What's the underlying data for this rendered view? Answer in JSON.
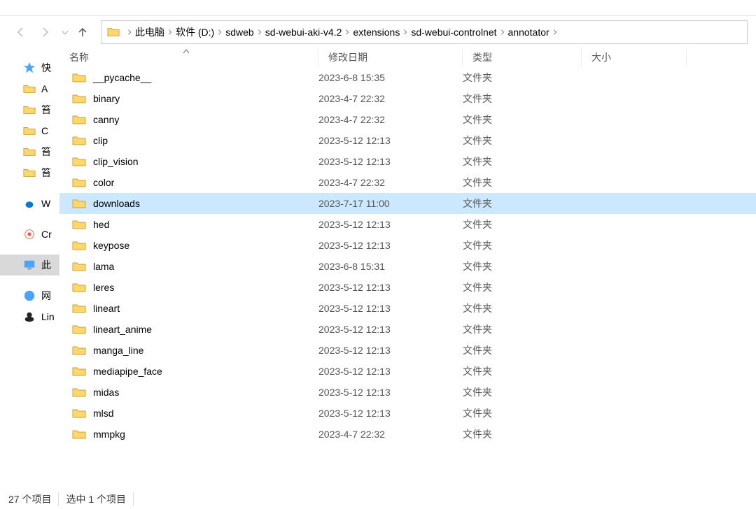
{
  "nav": {
    "back_enabled": false,
    "forward_enabled": false,
    "up_enabled": true
  },
  "breadcrumb": [
    "此电脑",
    "软件 (D:)",
    "sdweb",
    "sd-webui-aki-v4.2",
    "extensions",
    "sd-webui-controlnet",
    "annotator"
  ],
  "sidebar": {
    "quick_access_label": "快",
    "items": [
      "A",
      "笞",
      "C",
      "笞",
      "笞"
    ],
    "items2": [
      "W"
    ],
    "items3": [
      "Cr"
    ],
    "items4": [
      "此"
    ],
    "items5": [
      "网",
      "Lin"
    ]
  },
  "columns": {
    "name": "名称",
    "date": "修改日期",
    "type": "类型",
    "size": "大小"
  },
  "rows": [
    {
      "name": "__pycache__",
      "date": "2023-6-8 15:35",
      "type": "文件夹",
      "selected": false
    },
    {
      "name": "binary",
      "date": "2023-4-7 22:32",
      "type": "文件夹",
      "selected": false
    },
    {
      "name": "canny",
      "date": "2023-4-7 22:32",
      "type": "文件夹",
      "selected": false
    },
    {
      "name": "clip",
      "date": "2023-5-12 12:13",
      "type": "文件夹",
      "selected": false
    },
    {
      "name": "clip_vision",
      "date": "2023-5-12 12:13",
      "type": "文件夹",
      "selected": false
    },
    {
      "name": "color",
      "date": "2023-4-7 22:32",
      "type": "文件夹",
      "selected": false
    },
    {
      "name": "downloads",
      "date": "2023-7-17 11:00",
      "type": "文件夹",
      "selected": true
    },
    {
      "name": "hed",
      "date": "2023-5-12 12:13",
      "type": "文件夹",
      "selected": false
    },
    {
      "name": "keypose",
      "date": "2023-5-12 12:13",
      "type": "文件夹",
      "selected": false
    },
    {
      "name": "lama",
      "date": "2023-6-8 15:31",
      "type": "文件夹",
      "selected": false
    },
    {
      "name": "leres",
      "date": "2023-5-12 12:13",
      "type": "文件夹",
      "selected": false
    },
    {
      "name": "lineart",
      "date": "2023-5-12 12:13",
      "type": "文件夹",
      "selected": false
    },
    {
      "name": "lineart_anime",
      "date": "2023-5-12 12:13",
      "type": "文件夹",
      "selected": false
    },
    {
      "name": "manga_line",
      "date": "2023-5-12 12:13",
      "type": "文件夹",
      "selected": false
    },
    {
      "name": "mediapipe_face",
      "date": "2023-5-12 12:13",
      "type": "文件夹",
      "selected": false
    },
    {
      "name": "midas",
      "date": "2023-5-12 12:13",
      "type": "文件夹",
      "selected": false
    },
    {
      "name": "mlsd",
      "date": "2023-5-12 12:13",
      "type": "文件夹",
      "selected": false
    },
    {
      "name": "mmpkg",
      "date": "2023-4-7 22:32",
      "type": "文件夹",
      "selected": false
    }
  ],
  "status": {
    "item_count": "27 个项目",
    "selection": "选中 1 个项目"
  }
}
